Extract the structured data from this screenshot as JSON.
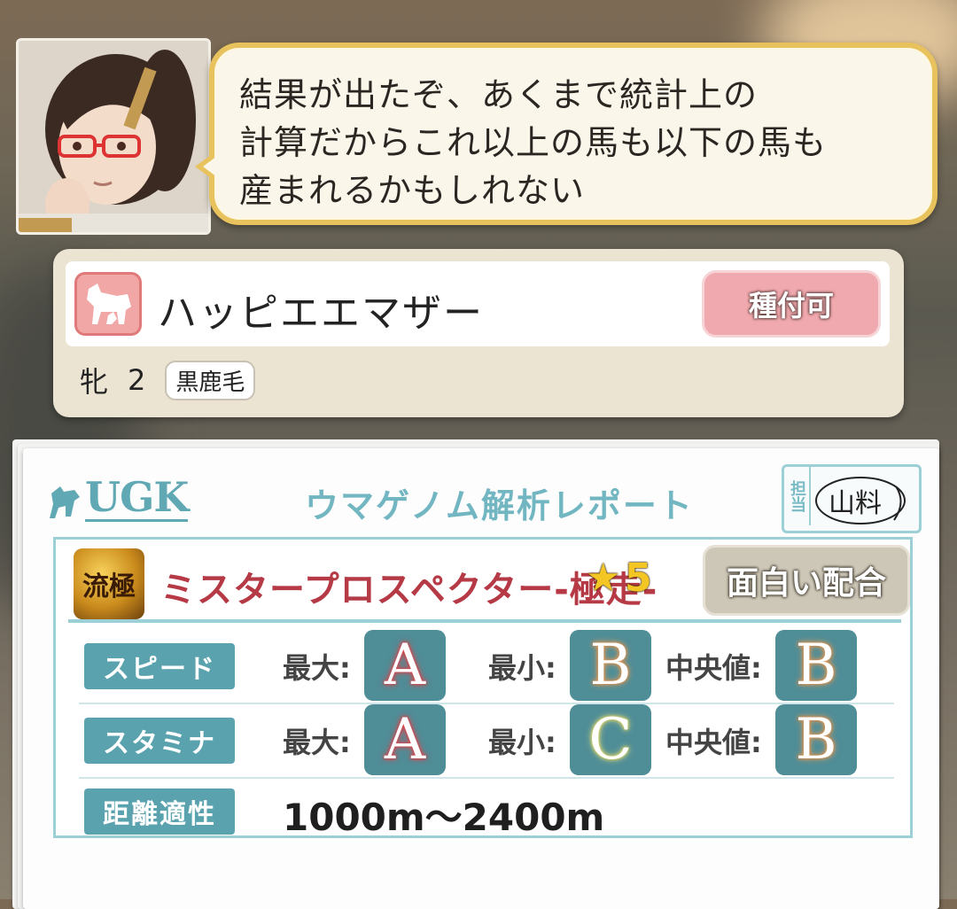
{
  "dialog": {
    "text": "結果が出たぞ、あくまで統計上の\n計算だからこれ以上の馬も以下の馬も\n産まれるかもしれない"
  },
  "horse": {
    "name": "ハッピエエマザー",
    "breed_button": "種付可",
    "sex": "牝",
    "age": "2",
    "coat": "黒鹿毛"
  },
  "report": {
    "logo": "UGK",
    "title": "ウマゲノム解析レポート",
    "stamp_label": "担当",
    "stamp_signature": "山料",
    "sire": {
      "icon_text": "流極",
      "name": "ミスタープロスペクター-極走-",
      "star": "★",
      "rank": "5",
      "combo_label": "面白い配合"
    },
    "stats": [
      {
        "label": "スピード",
        "max_key": "最大:",
        "max": "A",
        "min_key": "最小:",
        "min": "B",
        "median_key": "中央値:",
        "median": "B"
      },
      {
        "label": "スタミナ",
        "max_key": "最大:",
        "max": "A",
        "min_key": "最小:",
        "min": "C",
        "median_key": "中央値:",
        "median": "B"
      }
    ],
    "distance": {
      "label": "距離適性",
      "value": "1000m〜2400m"
    }
  },
  "colors": {
    "accent_teal": "#5aa3ae",
    "grade_box": "#4f8d97",
    "bubble_border": "#e8c25c",
    "breed_button": "#f0a9ae",
    "sire_name": "#b53a46"
  }
}
